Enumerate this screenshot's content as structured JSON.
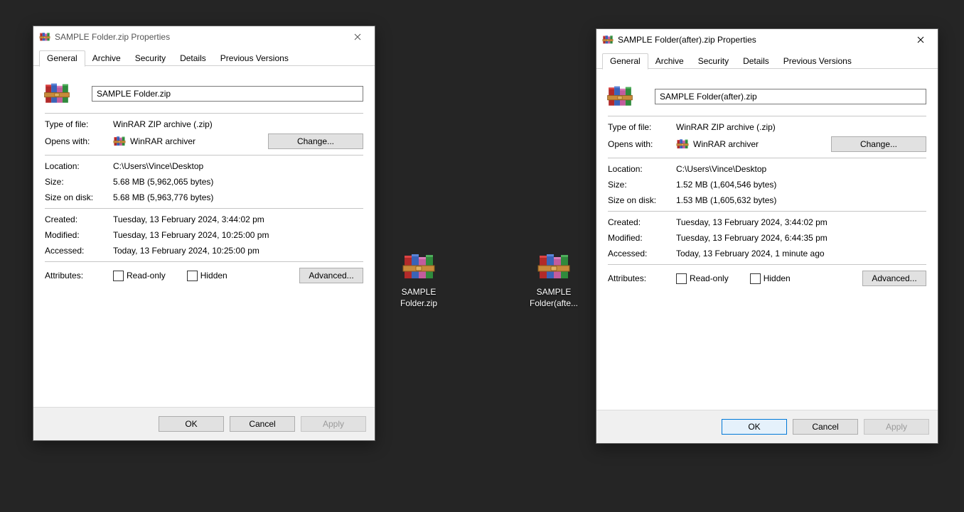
{
  "tabs": {
    "general": "General",
    "archive": "Archive",
    "security": "Security",
    "details": "Details",
    "previous": "Previous Versions"
  },
  "labels": {
    "type_of_file": "Type of file:",
    "opens_with": "Opens with:",
    "location": "Location:",
    "size": "Size:",
    "size_on_disk": "Size on disk:",
    "created": "Created:",
    "modified": "Modified:",
    "accessed": "Accessed:",
    "attributes": "Attributes:",
    "readonly": "Read-only",
    "hidden": "Hidden",
    "change": "Change...",
    "advanced": "Advanced...",
    "ok": "OK",
    "cancel": "Cancel",
    "apply": "Apply"
  },
  "dialog1": {
    "title": "SAMPLE Folder.zip Properties",
    "filename": "SAMPLE Folder.zip",
    "type": "WinRAR ZIP archive (.zip)",
    "opens_with": "WinRAR archiver",
    "location": "C:\\Users\\Vince\\Desktop",
    "size": "5.68 MB (5,962,065 bytes)",
    "size_on_disk": "5.68 MB (5,963,776 bytes)",
    "created": "Tuesday, 13 February 2024, 3:44:02 pm",
    "modified": "Tuesday, 13 February 2024, 10:25:00 pm",
    "accessed": "Today, 13 February 2024, 10:25:00 pm"
  },
  "dialog2": {
    "title": "SAMPLE Folder(after).zip Properties",
    "filename": "SAMPLE Folder(after).zip",
    "type": "WinRAR ZIP archive (.zip)",
    "opens_with": "WinRAR archiver",
    "location": "C:\\Users\\Vince\\Desktop",
    "size": "1.52 MB (1,604,546 bytes)",
    "size_on_disk": "1.53 MB (1,605,632 bytes)",
    "created": "Tuesday, 13 February 2024, 3:44:02 pm",
    "modified": "Tuesday, 13 February 2024, 6:44:35 pm",
    "accessed": "Today, 13 February 2024, 1 minute ago"
  },
  "desktop": {
    "icon1": "SAMPLE Folder.zip",
    "icon2": "SAMPLE Folder(afte..."
  }
}
